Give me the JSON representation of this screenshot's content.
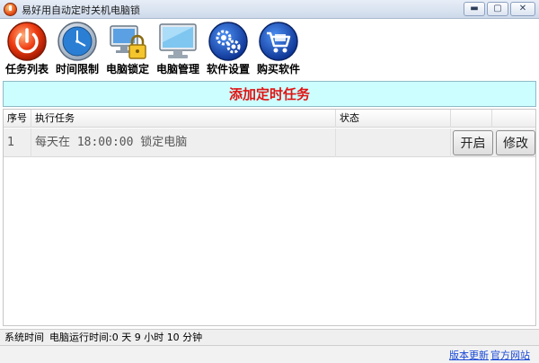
{
  "window": {
    "title": "易好用自动定时关机电脑锁",
    "minimize": "▬",
    "maximize": "▢",
    "close": "✕"
  },
  "toolbar": {
    "items": [
      {
        "label": "任务列表",
        "icon": "power-icon"
      },
      {
        "label": "时间限制",
        "icon": "clock-icon"
      },
      {
        "label": "电脑锁定",
        "icon": "lock-computer-icon"
      },
      {
        "label": "电脑管理",
        "icon": "monitor-icon"
      },
      {
        "label": "软件设置",
        "icon": "gears-icon"
      },
      {
        "label": "购买软件",
        "icon": "cart-icon"
      }
    ]
  },
  "add_task": "添加定时任务",
  "table": {
    "columns": [
      "序号",
      "执行任务",
      "状态"
    ],
    "rows": [
      {
        "seq": "1",
        "task": "每天在 18:00:00 锁定电脑",
        "status": "",
        "start_label": "开启",
        "edit_label": "修改"
      }
    ]
  },
  "statusbar": {
    "system_time": "系统时间",
    "uptime": "电脑运行时间:0 天 9 小时 10 分钟"
  },
  "footer": {
    "update_link": "版本更新",
    "website_link": "官方网站"
  },
  "colors": {
    "add_bar_bg": "#ccfeff",
    "add_bar_text": "#e11313",
    "link": "#1a49d6"
  }
}
